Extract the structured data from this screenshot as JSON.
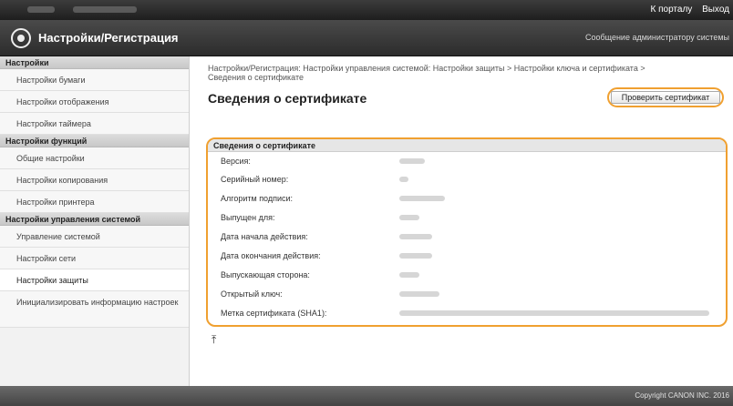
{
  "topbar": {
    "link_portal": "К порталу",
    "link_logout": "Выход"
  },
  "header": {
    "title": "Настройки/Регистрация",
    "message": "Сообщение администратору системы"
  },
  "sidebar": {
    "sections": [
      {
        "label": "Настройки",
        "items": [
          "Настройки бумаги",
          "Настройки отображения",
          "Настройки таймера"
        ]
      },
      {
        "label": "Настройки функций",
        "items": [
          "Общие настройки",
          "Настройки копирования",
          "Настройки принтера"
        ]
      },
      {
        "label": "Настройки управления системой",
        "items": [
          "Управление системой",
          "Настройки сети",
          "Настройки защиты",
          "Инициализировать информацию настроек"
        ]
      }
    ]
  },
  "main": {
    "breadcrumb_line1": "Настройки/Регистрация: Настройки управления системой: Настройки защиты > Настройки ключа и сертификата >",
    "breadcrumb_line2": "Сведения о сертификате",
    "title": "Сведения о сертификате",
    "check_button": "Проверить сертификат",
    "cert_box_title": "Сведения о сертификате",
    "fields": [
      "Версия:",
      "Серийный номер:",
      "Алгоритм подписи:",
      "Выпущен для:",
      "Дата начала действия:",
      "Дата окончания действия:",
      "Выпускающая сторона:",
      "Открытый ключ:",
      "Метка сертификата (SHA1):"
    ]
  },
  "footer": {
    "copyright": "Copyright CANON INC. 2016"
  }
}
